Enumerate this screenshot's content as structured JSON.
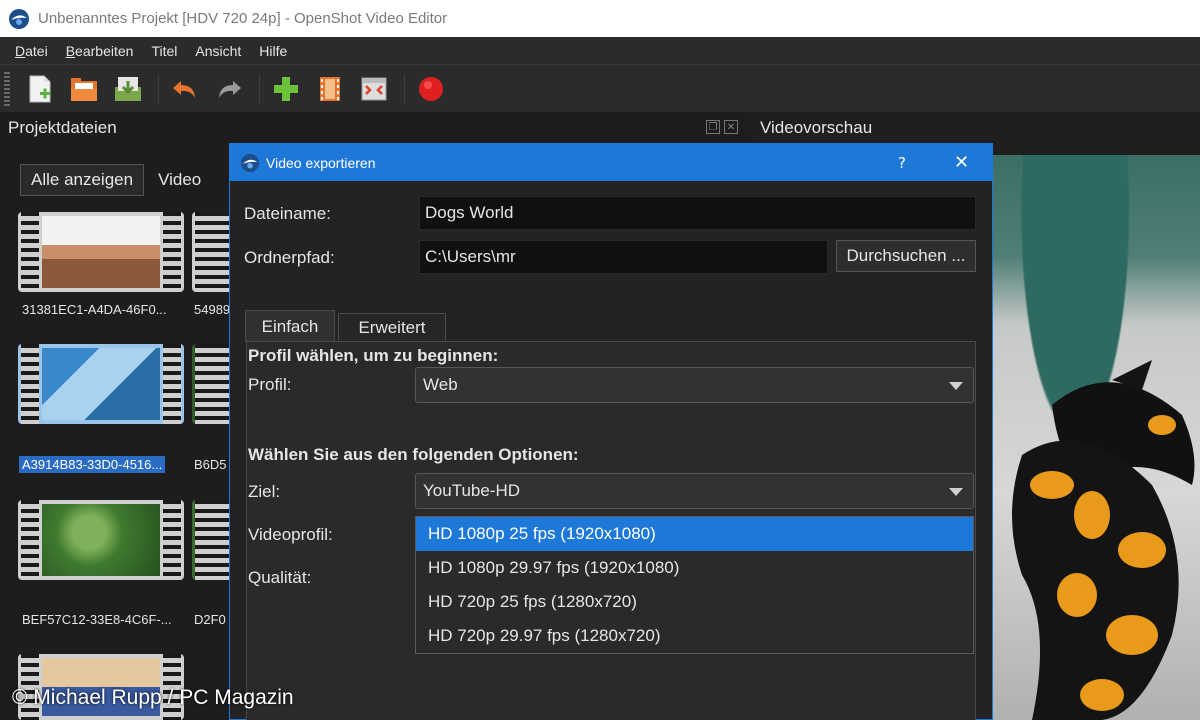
{
  "window": {
    "title": "Unbenanntes Projekt [HDV 720 24p] - OpenShot Video Editor"
  },
  "menu": {
    "items": [
      {
        "label": "Datei",
        "accel": "D",
        "rest": "atei"
      },
      {
        "label": "Bearbeiten",
        "accel": "B",
        "rest": "earbeiten"
      },
      {
        "label": "Titel",
        "accel": "",
        "rest": "Titel"
      },
      {
        "label": "Ansicht",
        "accel": "",
        "rest": "Ansicht"
      },
      {
        "label": "Hilfe",
        "accel": "",
        "rest": "Hilfe"
      }
    ]
  },
  "toolbar": {
    "icons": [
      "new-file-icon",
      "open-folder-icon",
      "save-icon",
      "undo-icon",
      "redo-icon",
      "add-icon",
      "film-icon",
      "fullscreen-icon",
      "record-icon"
    ]
  },
  "left_panel": {
    "title": "Projektdateien",
    "filter_all": "Alle anzeigen",
    "filter_video": "Video",
    "files": [
      {
        "label": "31381EC1-A4DA-46F0..."
      },
      {
        "label": "54989"
      },
      {
        "label": "A3914B83-33D0-4516...",
        "selected": true
      },
      {
        "label": "B6D5"
      },
      {
        "label": "BEF57C12-33E8-4C6F-..."
      },
      {
        "label": "D2F0"
      }
    ]
  },
  "preview": {
    "title": "Videovorschau"
  },
  "dialog": {
    "title": "Video exportieren",
    "help": "?",
    "close": "✕",
    "filename_label": "Dateiname:",
    "filename_value": "Dogs World",
    "folder_label": "Ordnerpfad:",
    "folder_value": "C:\\Users\\mr",
    "browse_label": "Durchsuchen ...",
    "tabs": [
      {
        "label": "Einfach",
        "active": true
      },
      {
        "label": "Erweitert",
        "active": false
      }
    ],
    "section_profile": "Profil wählen, um zu beginnen:",
    "profile_label": "Profil:",
    "profile_value": "Web",
    "section_options": "Wählen Sie aus den folgenden Optionen:",
    "target_label": "Ziel:",
    "target_value": "YouTube-HD",
    "videoprofile_label": "Videoprofil:",
    "quality_label": "Qualität:",
    "videoprofile_options": [
      {
        "label": "HD 1080p 25 fps (1920x1080)",
        "selected": true
      },
      {
        "label": "HD 1080p 29.97 fps (1920x1080)",
        "selected": false
      },
      {
        "label": "HD 720p 25 fps (1280x720)",
        "selected": false
      },
      {
        "label": "HD 720p 29.97 fps (1280x720)",
        "selected": false
      }
    ]
  },
  "watermark": "© Michael Rupp / PC Magazin"
}
